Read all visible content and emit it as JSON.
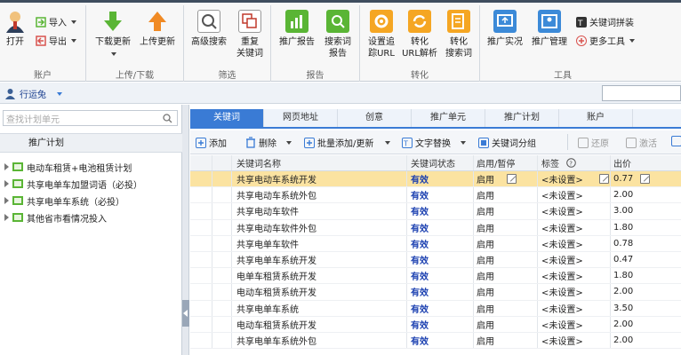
{
  "ribbon": {
    "open": "打开",
    "import": "导入",
    "export": "导出",
    "download": "下载更新",
    "upload": "上传更新",
    "adv_search": "高级搜索",
    "dup_kw_1": "重复",
    "dup_kw_2": "关键词",
    "promo_report": "推广报告",
    "search_report_1": "搜索词",
    "search_report_2": "报告",
    "track_url_1": "设置追",
    "track_url_2": "踪URL",
    "convert_url_1": "转化",
    "convert_url_2": "URL解析",
    "convert_search_1": "转化",
    "convert_search_2": "搜索词",
    "promo_realtime": "推广实况",
    "promo_manage": "推广管理",
    "kw_combine": "关键词拼装",
    "more_tools": "更多工具",
    "groups": {
      "account": "账户",
      "updown": "上传/下载",
      "filter": "筛选",
      "report": "报告",
      "convert": "转化",
      "tools": "工具"
    }
  },
  "userbar": {
    "user": "行运兔"
  },
  "sidebar": {
    "search_placeholder": "查找计划单元",
    "header": "推广计划",
    "items": [
      {
        "label": "电动车租赁+电池租赁计划"
      },
      {
        "label": "共享电单车加盟词语（必投）"
      },
      {
        "label": "共享电单车系统（必投）"
      },
      {
        "label": "其他省市看情况投入"
      }
    ]
  },
  "tabs": [
    "关键词",
    "网页地址",
    "创意",
    "推广单元",
    "推广计划",
    "账户"
  ],
  "toolbar": {
    "add": "添加",
    "delete": "删除",
    "batch": "批量添加/更新",
    "replace": "文字替换",
    "group": "关键词分组",
    "restore": "还原",
    "activate": "激活"
  },
  "table": {
    "headers": {
      "name": "关键词名称",
      "status": "关键词状态",
      "enable": "启用/暂停",
      "tag": "标签",
      "bid": "出价"
    },
    "rows": [
      {
        "name": "共享电动车系统开发",
        "status": "有效",
        "enable": "启用",
        "tag": "<未设置>",
        "bid": "0.77"
      },
      {
        "name": "共享电动车系统外包",
        "status": "有效",
        "enable": "启用",
        "tag": "<未设置>",
        "bid": "2.00"
      },
      {
        "name": "共享电动车软件",
        "status": "有效",
        "enable": "启用",
        "tag": "<未设置>",
        "bid": "3.00"
      },
      {
        "name": "共享电动车软件外包",
        "status": "有效",
        "enable": "启用",
        "tag": "<未设置>",
        "bid": "1.80"
      },
      {
        "name": "共享电单车软件",
        "status": "有效",
        "enable": "启用",
        "tag": "<未设置>",
        "bid": "0.78"
      },
      {
        "name": "共享电单车系统开发",
        "status": "有效",
        "enable": "启用",
        "tag": "<未设置>",
        "bid": "0.47"
      },
      {
        "name": "电单车租赁系统开发",
        "status": "有效",
        "enable": "启用",
        "tag": "<未设置>",
        "bid": "1.80"
      },
      {
        "name": "电动车租赁系统开发",
        "status": "有效",
        "enable": "启用",
        "tag": "<未设置>",
        "bid": "2.00"
      },
      {
        "name": "共享电单车系统",
        "status": "有效",
        "enable": "启用",
        "tag": "<未设置>",
        "bid": "3.50"
      },
      {
        "name": "电动车租赁系统开发",
        "status": "有效",
        "enable": "启用",
        "tag": "<未设置>",
        "bid": "2.00"
      },
      {
        "name": "共享电单车系统外包",
        "status": "有效",
        "enable": "启用",
        "tag": "<未设置>",
        "bid": "2.00"
      }
    ]
  },
  "colors": {
    "accent": "#3a7bd5",
    "selected_row": "#fbe3a1",
    "status_text": "#1a3fb0"
  }
}
